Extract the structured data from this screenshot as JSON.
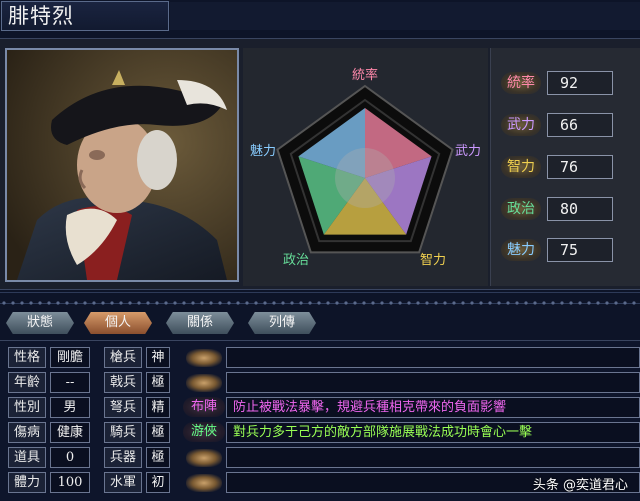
{
  "title": "腓特烈",
  "colors": {
    "tongshuai": "#ff88aa",
    "wuli": "#cc99ff",
    "zhili": "#f0d050",
    "zhengzhi": "#66dd99",
    "meili": "#88ccff",
    "tag_buzhen": "#ee66ee",
    "tag_youxia": "#66ff88",
    "desc_buzhen": "#ee66ee",
    "desc_youxia": "#99ff55"
  },
  "radar": {
    "labels": [
      "統率",
      "武力",
      "智力",
      "政治",
      "魅力"
    ]
  },
  "stats": [
    {
      "label": "統率",
      "value": "92",
      "key": "tongshuai"
    },
    {
      "label": "武力",
      "value": "66",
      "key": "wuli"
    },
    {
      "label": "智力",
      "value": "76",
      "key": "zhili"
    },
    {
      "label": "政治",
      "value": "80",
      "key": "zhengzhi"
    },
    {
      "label": "魅力",
      "value": "75",
      "key": "meili"
    }
  ],
  "tabs": [
    "狀態",
    "個人",
    "關係",
    "列傳"
  ],
  "active_tab": "個人",
  "personal": [
    {
      "label": "性格",
      "value": "剛膽"
    },
    {
      "label": "年齡",
      "value": "--"
    },
    {
      "label": "性別",
      "value": "男"
    },
    {
      "label": "傷病",
      "value": "健康"
    },
    {
      "label": "道具",
      "value": "0"
    },
    {
      "label": "體力",
      "value": "100"
    }
  ],
  "aptitude": [
    {
      "label": "槍兵",
      "value": "神"
    },
    {
      "label": "戟兵",
      "value": "極"
    },
    {
      "label": "弩兵",
      "value": "精"
    },
    {
      "label": "騎兵",
      "value": "極"
    },
    {
      "label": "兵器",
      "value": "極"
    },
    {
      "label": "水軍",
      "value": "初"
    }
  ],
  "skills": [
    {
      "tag": "",
      "desc": ""
    },
    {
      "tag": "",
      "desc": ""
    },
    {
      "tag": "布陣",
      "desc": "防止被戰法暴擊，規避兵種相克帶來的負面影響"
    },
    {
      "tag": "游俠",
      "desc": "對兵力多于己方的敵方部隊施展戰法成功時會心一擊"
    },
    {
      "tag": "",
      "desc": ""
    },
    {
      "tag": "",
      "desc": ""
    }
  ],
  "watermark": "头条 @奕道君心"
}
